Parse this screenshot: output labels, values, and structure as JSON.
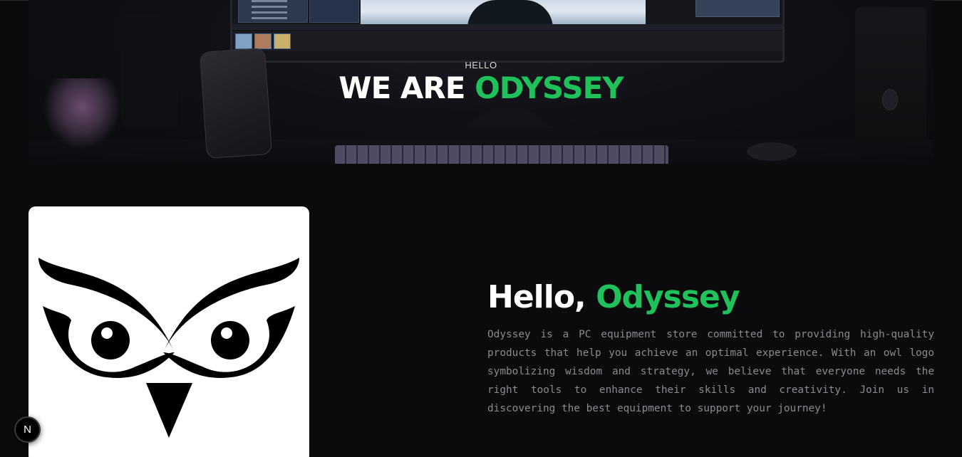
{
  "hero": {
    "kicker": "HELLO",
    "title_prefix": "WE ARE ",
    "title_brand": "ODYSSEY"
  },
  "about": {
    "title_prefix": "Hello, ",
    "title_brand": "Odyssey",
    "description": "Odyssey is a PC equipment store committed to providing high-quality products that help you achieve an optimal experience. With an owl logo symbolizing wisdom and strategy, we believe that everyone needs the right tools to enhance their skills and creativity. Join us in discovering the best equipment to support your journey!"
  },
  "dev_badge": {
    "label": "N",
    "icon": "nextjs-icon"
  },
  "colors": {
    "accent": "#1fc15a",
    "background": "#0b0b0d",
    "text_muted": "#8a8a90"
  },
  "images": {
    "hero": "desk-setup-photo",
    "logo": "owl-logo"
  }
}
